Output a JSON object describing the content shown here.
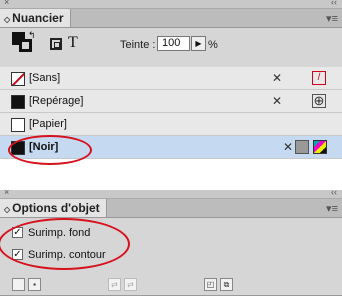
{
  "swatches_panel": {
    "close_glyph": "×",
    "collapse_glyph": "‹‹",
    "menu_glyph": "▾≡",
    "tab_chevron": "◇",
    "tab_label": "Nuancier",
    "format_glyph": "T",
    "tint_label": "Teinte :",
    "tint_value": "100",
    "tint_arrow": "▶",
    "tint_unit": "%",
    "rows": [
      {
        "name": "[Sans]",
        "chip": "none",
        "icons": [
          "pencil-crossed",
          "none-swatch"
        ]
      },
      {
        "name": "[Repérage]",
        "chip": "black",
        "icons": [
          "pencil-crossed",
          "registration"
        ]
      },
      {
        "name": "[Papier]",
        "chip": "white",
        "icons": []
      },
      {
        "name": "[Noir]",
        "chip": "black",
        "selected": true,
        "icons": [
          "pencil-crossed",
          "process-color",
          "cmyk"
        ]
      }
    ],
    "pencil_glyph": "✕",
    "reg_glyph": "⊕",
    "none_glyph": "/"
  },
  "attributes_panel": {
    "close_glyph": "×",
    "collapse_glyph": "‹‹",
    "menu_glyph": "▾≡",
    "tab_chevron": "◇",
    "tab_label": "Options d'objet",
    "overprint_fill_label": "Surimp. fond",
    "overprint_fill_checked": true,
    "overprint_stroke_label": "Surimp. contour",
    "overprint_stroke_checked": true,
    "check_glyph": "✓"
  },
  "colors": {
    "highlight_ellipse": "#d5121d",
    "selected_row": "#c5d9f1"
  }
}
